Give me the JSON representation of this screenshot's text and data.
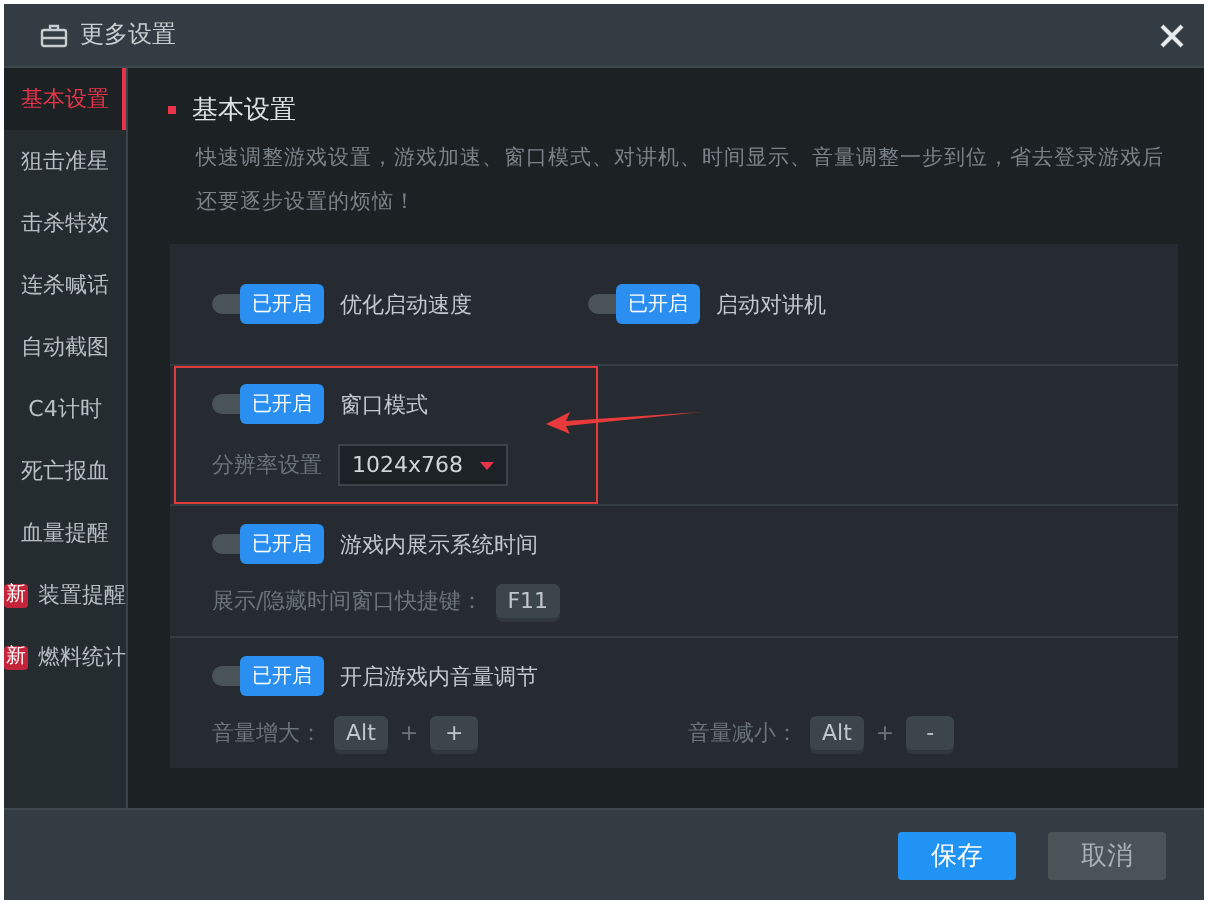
{
  "window": {
    "title": "更多设置"
  },
  "sidebar": {
    "items": [
      {
        "label": "基本设置",
        "selected": true
      },
      {
        "label": "狙击准星",
        "selected": false
      },
      {
        "label": "击杀特效",
        "selected": false
      },
      {
        "label": "连杀喊话",
        "selected": false
      },
      {
        "label": "自动截图",
        "selected": false
      },
      {
        "label": "C4计时",
        "selected": false
      },
      {
        "label": "死亡报血",
        "selected": false
      },
      {
        "label": "血量提醒",
        "selected": false
      },
      {
        "label": "装置提醒",
        "selected": false,
        "badge": "新"
      },
      {
        "label": "燃料统计",
        "selected": false,
        "badge": "新"
      }
    ]
  },
  "section": {
    "title": "基本设置",
    "description": "快速调整游戏设置，游戏加速、窗口模式、对讲机、时间显示、音量调整一步到位，省去登录游戏后还要逐步设置的烦恼！"
  },
  "settings": [
    {
      "highlighted": false,
      "toggles": [
        {
          "on": true,
          "status": "已开启",
          "label": "优化启动速度"
        },
        {
          "on": true,
          "status": "已开启",
          "label": "启动对讲机"
        }
      ]
    },
    {
      "highlighted": true,
      "toggles": [
        {
          "on": true,
          "status": "已开启",
          "label": "窗口模式"
        }
      ],
      "resolution": {
        "label": "分辨率设置",
        "value": "1024x768"
      }
    },
    {
      "highlighted": false,
      "toggles": [
        {
          "on": true,
          "status": "已开启",
          "label": "游戏内展示系统时间"
        }
      ],
      "hotkeys": [
        {
          "label": "展示/隐藏时间窗口快捷键：",
          "keys": [
            "F11"
          ]
        }
      ]
    },
    {
      "highlighted": false,
      "toggles": [
        {
          "on": true,
          "status": "已开启",
          "label": "开启游戏内音量调节"
        }
      ],
      "hotkeys": [
        {
          "label": "音量增大：",
          "keys": [
            "Alt",
            "+"
          ],
          "joiner": "+"
        },
        {
          "label": "音量减小：",
          "keys": [
            "Alt",
            "-"
          ],
          "joiner": "+"
        }
      ]
    }
  ],
  "buttons": [
    {
      "label": "保存",
      "kind": "primary"
    },
    {
      "label": "取消",
      "kind": "secondary"
    }
  ]
}
